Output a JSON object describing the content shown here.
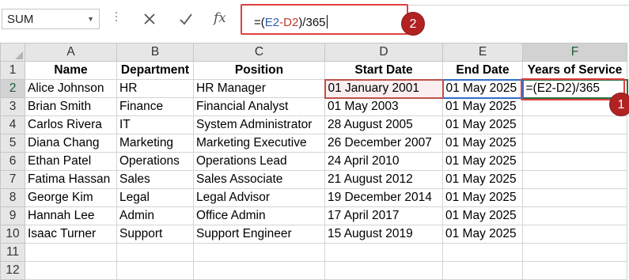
{
  "formula_bar": {
    "name_box": "SUM",
    "cancel_icon": "close-icon",
    "enter_icon": "checkmark-icon",
    "fx_label": "fx",
    "formula": {
      "open": "=(",
      "ref1": "E2",
      "minus": "-",
      "ref2": "D2",
      "close": ")/365"
    }
  },
  "callouts": {
    "first": "1",
    "second": "2"
  },
  "columns": [
    "A",
    "B",
    "C",
    "D",
    "E",
    "F"
  ],
  "rows": [
    [
      "Name",
      "Department",
      "Position",
      "Start Date",
      "End Date",
      "Years of Service"
    ],
    [
      "Alice Johnson",
      "HR",
      "HR Manager",
      "01 January 2001",
      "01 May 2025",
      "=(E2-D2)/365"
    ],
    [
      "Brian Smith",
      "Finance",
      "Financial Analyst",
      "01 May 2003",
      "01 May 2025",
      ""
    ],
    [
      "Carlos Rivera",
      "IT",
      "System Administrator",
      "28 August 2005",
      "01 May 2025",
      ""
    ],
    [
      "Diana Chang",
      "Marketing",
      "Marketing Executive",
      "26 December 2007",
      "01 May 2025",
      ""
    ],
    [
      "Ethan Patel",
      "Operations",
      "Operations Lead",
      "24 April 2010",
      "01 May 2025",
      ""
    ],
    [
      "Fatima Hassan",
      "Sales",
      "Sales Associate",
      "21 August 2012",
      "01 May 2025",
      ""
    ],
    [
      "George Kim",
      "Legal",
      "Legal Advisor",
      "19 December 2014",
      "01 May 2025",
      ""
    ],
    [
      "Hannah Lee",
      "Admin",
      "Office Admin",
      "17 April 2017",
      "01 May 2025",
      ""
    ],
    [
      "Isaac Turner",
      "Support",
      "Support Engineer",
      "15 August 2019",
      "01 May 2025",
      ""
    ],
    [
      "",
      "",
      "",
      "",
      "",
      ""
    ],
    [
      "",
      "",
      "",
      "",
      "",
      ""
    ]
  ],
  "row_numbers": [
    "1",
    "2",
    "3",
    "4",
    "5",
    "6",
    "7",
    "8",
    "9",
    "10",
    "11",
    "12"
  ],
  "colors": {
    "accent_green": "#217346",
    "ref_red": "#c0504d",
    "ref_blue": "#2f6fc9",
    "callout_red": "#b22222"
  }
}
